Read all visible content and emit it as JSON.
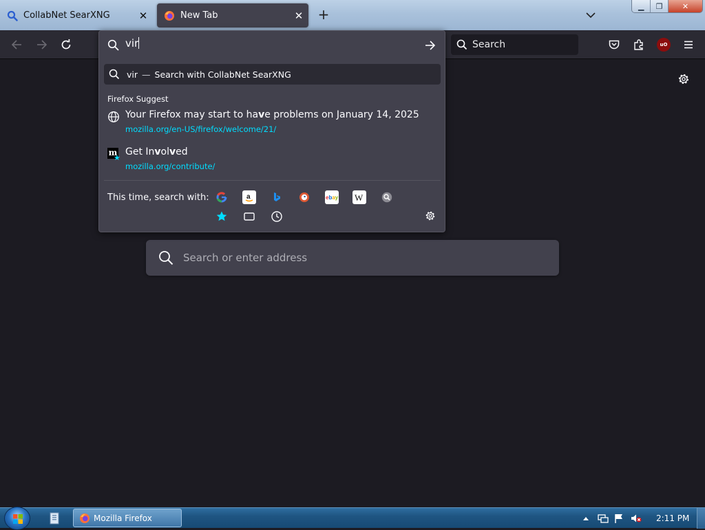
{
  "colors": {
    "accent": "#00ddff",
    "panel": "#42414d",
    "toolbar": "#2b2a33",
    "page_bg": "#1c1b22",
    "firefox_orange": "#ff7139"
  },
  "tabs": [
    {
      "label": "CollabNet SearXNG",
      "icon": "search-icon",
      "active": false
    },
    {
      "label": "New Tab",
      "icon": "firefox-icon",
      "active": true
    }
  ],
  "toolbar": {
    "search_placeholder": "Search"
  },
  "urlbar": {
    "typed_before_caret": "vir",
    "heuristic": {
      "query": "vir",
      "separator": "—",
      "action": "Search with CollabNet SearXNG"
    },
    "suggest_heading": "Firefox Suggest",
    "suggestions": [
      {
        "title_parts": [
          "Your Firefox may start to ha",
          "v",
          "e problems on January 14, 2025"
        ],
        "url": "mozilla.org/en-US/firefox/welcome/21/",
        "icon": "globe-icon"
      },
      {
        "title_parts": [
          "Get In",
          "v",
          "ol",
          "v",
          "ed"
        ],
        "url": "mozilla.org/contribute/",
        "icon": "mozilla-bookmark-icon"
      }
    ],
    "oneoff_label": "This time, search with:",
    "engines": [
      "google-icon",
      "amazon-icon",
      "bing-icon",
      "duckduckgo-icon",
      "ebay-icon",
      "wikipedia-icon",
      "searxng-icon",
      "bookmarks-icon",
      "tabs-icon",
      "history-icon"
    ]
  },
  "page": {
    "search_placeholder": "Search or enter address"
  },
  "taskbar": {
    "app_label": "Mozilla Firefox",
    "clock": "2:11 PM"
  }
}
